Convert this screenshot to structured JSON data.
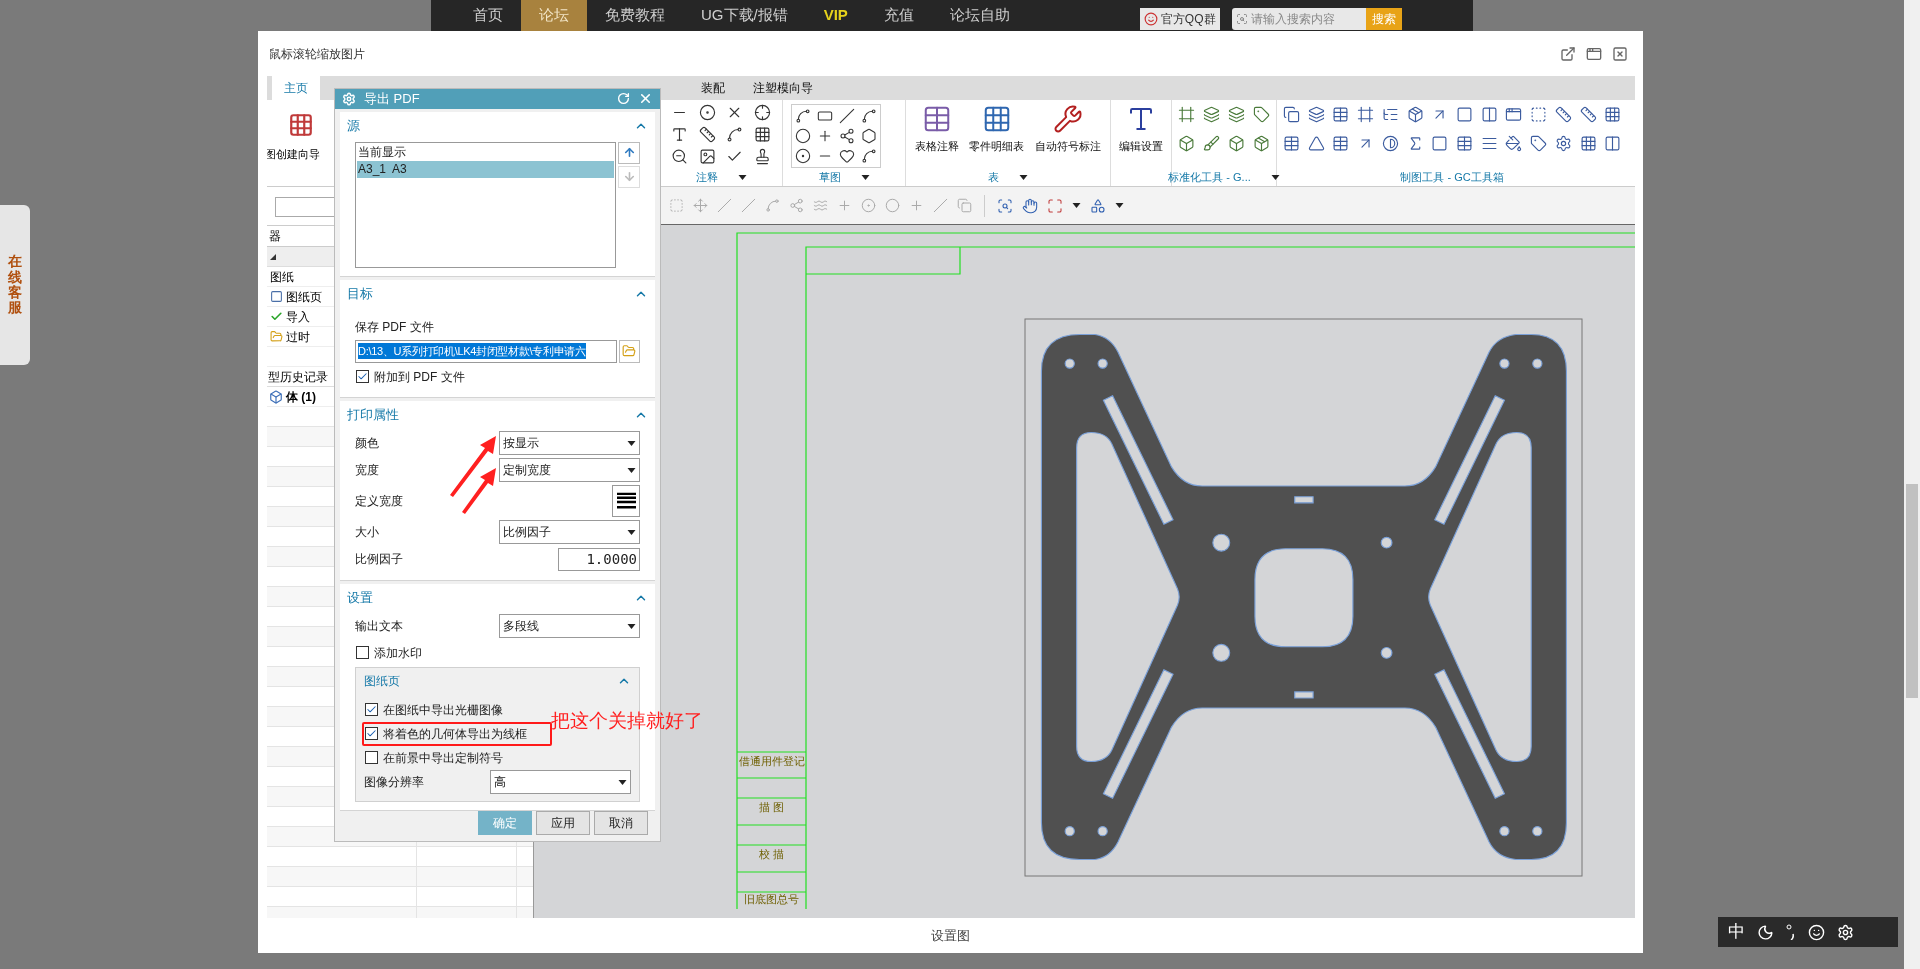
{
  "site_nav": {
    "items": [
      {
        "label": "首页",
        "selected": false,
        "kind": "link"
      },
      {
        "label": "论坛",
        "selected": true,
        "kind": "link"
      },
      {
        "label": "免费教程",
        "selected": false,
        "kind": "link"
      },
      {
        "label": "UG下载/报错",
        "selected": false,
        "kind": "link"
      },
      {
        "label": "VIP",
        "selected": false,
        "kind": "vip"
      },
      {
        "label": "充值",
        "selected": false,
        "kind": "link"
      },
      {
        "label": "论坛自助",
        "selected": false,
        "kind": "link"
      }
    ],
    "qq_button": "官方QQ群",
    "search": {
      "placeholder": "请输入搜索内容",
      "button": "搜索"
    }
  },
  "side_tab": {
    "label": "在线客服"
  },
  "lightbox": {
    "title": "鼠标滚轮缩放图片",
    "caption": "设置图"
  },
  "screenshot": {
    "ribbon_tabs": [
      {
        "label": "主页",
        "selected": true
      },
      {
        "label": "装配",
        "selected": false
      },
      {
        "label": "注塑模向导",
        "selected": false
      }
    ],
    "ribbon": {
      "left_button": "图创建向导",
      "groups": [
        {
          "kind": "annotation",
          "label": "注释"
        },
        {
          "kind": "sketch",
          "label": "草图"
        },
        {
          "kind": "table",
          "label": "表",
          "buttons": [
            "表格注释",
            "零件明细表",
            "自动符号标注"
          ]
        },
        {
          "kind": "edit",
          "button": "编辑设置"
        },
        {
          "kind": "standard",
          "label": "标准化工具 - G..."
        },
        {
          "kind": "gc",
          "label": "制图工具 - GC工具箱"
        }
      ]
    },
    "navigator": {
      "header": "器",
      "items": [
        {
          "label": "图纸",
          "kind": "plain"
        },
        {
          "label": "图纸页",
          "kind": "sheet"
        },
        {
          "label": "导入",
          "kind": "imported"
        },
        {
          "label": "过时",
          "kind": "folder"
        }
      ],
      "history_header": "型历史记录",
      "history_items": [
        {
          "label": "体 (1)",
          "kind": "body"
        }
      ]
    },
    "drawing": {
      "title_block": [
        "借通用件登记",
        "描 图",
        "校 描",
        "旧底图总号"
      ]
    },
    "dialog": {
      "title": "导出 PDF",
      "sections": [
        {
          "title": "源",
          "expanded": true,
          "rows": [
            {
              "kind": "list",
              "items": [
                {
                  "label": "当前显示",
                  "selected": false
                },
                {
                  "label": "A3_1  A3",
                  "selected": true
                }
              ]
            }
          ]
        },
        {
          "title": "目标",
          "expanded": true,
          "rows": [
            {
              "kind": "caption",
              "label": "保存 PDF 文件"
            },
            {
              "kind": "path",
              "value": "D:\\13、U系列打印机\\LK4封闭型材款\\专利申请六",
              "text_selected": true
            },
            {
              "kind": "checkbox",
              "label": "附加到 PDF 文件",
              "checked": true,
              "highlighted": false
            }
          ]
        },
        {
          "title": "打印属性",
          "expanded": true,
          "rows": [
            {
              "kind": "dropdown",
              "label": "颜色",
              "value": "按显示"
            },
            {
              "kind": "dropdown",
              "label": "宽度",
              "value": "定制宽度"
            },
            {
              "kind": "width",
              "label": "定义宽度"
            },
            {
              "kind": "dropdown",
              "label": "大小",
              "value": "比例因子"
            },
            {
              "kind": "number",
              "label": "比例因子",
              "value": "1.0000"
            }
          ]
        },
        {
          "title": "设置",
          "expanded": true,
          "rows": [
            {
              "kind": "dropdown",
              "label": "输出文本",
              "value": "多段线"
            },
            {
              "kind": "checkbox",
              "label": "添加水印",
              "checked": false,
              "highlighted": false
            },
            {
              "kind": "subgroup",
              "title": "图纸页",
              "expanded": true,
              "rows": [
                {
                  "kind": "checkbox",
                  "label": "在图纸中导出光栅图像",
                  "checked": true,
                  "highlighted": false
                },
                {
                  "kind": "checkbox",
                  "label": "将着色的几何体导出为线框",
                  "checked": true,
                  "highlighted": true
                },
                {
                  "kind": "checkbox",
                  "label": "在前景中导出定制符号",
                  "checked": false,
                  "highlighted": false
                },
                {
                  "kind": "dropdown",
                  "label": "图像分辨率",
                  "value": "高"
                }
              ]
            }
          ]
        }
      ],
      "buttons": [
        {
          "label": "确定",
          "kind": "primary"
        },
        {
          "label": "应用",
          "kind": "normal"
        },
        {
          "label": "取消",
          "kind": "normal"
        }
      ]
    },
    "annotation": {
      "note": "把这个关掉就好了"
    }
  },
  "ime": {
    "mode": "中"
  }
}
